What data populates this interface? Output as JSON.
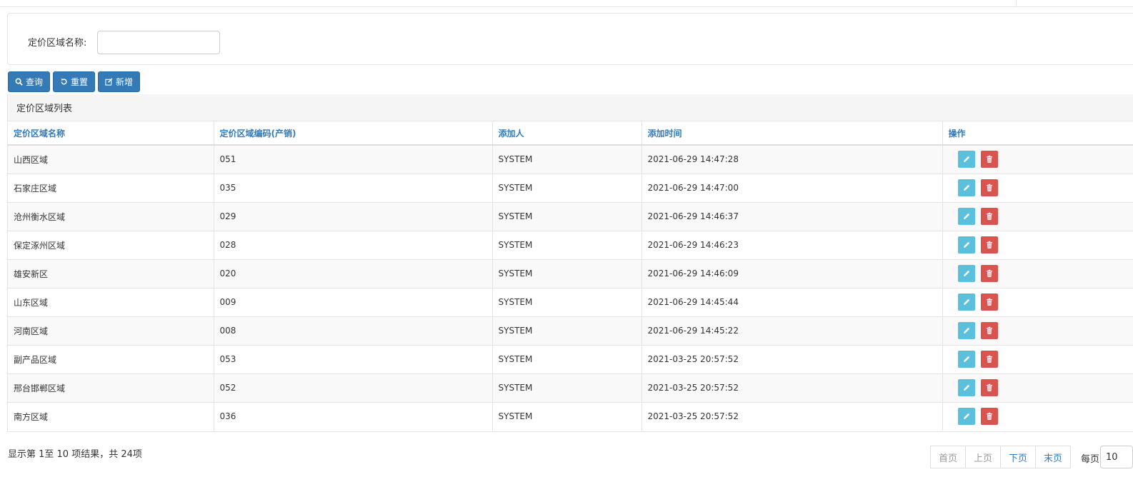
{
  "search": {
    "label": "定价区域名称:",
    "value": "",
    "placeholder": ""
  },
  "toolbar": {
    "query_label": "查询",
    "reset_label": "重置",
    "add_label": "新增"
  },
  "list": {
    "heading": "定价区域列表",
    "columns": [
      "定价区域名称",
      "定价区域编码(产销)",
      "添加人",
      "添加时间",
      "操作"
    ],
    "rows": [
      {
        "name": "山西区域",
        "code": "051",
        "creator": "SYSTEM",
        "time": "2021-06-29 14:47:28"
      },
      {
        "name": "石家庄区域",
        "code": "035",
        "creator": "SYSTEM",
        "time": "2021-06-29 14:47:00"
      },
      {
        "name": "沧州衡水区域",
        "code": "029",
        "creator": "SYSTEM",
        "time": "2021-06-29 14:46:37"
      },
      {
        "name": "保定涿州区域",
        "code": "028",
        "creator": "SYSTEM",
        "time": "2021-06-29 14:46:23"
      },
      {
        "name": "雄安新区",
        "code": "020",
        "creator": "SYSTEM",
        "time": "2021-06-29 14:46:09"
      },
      {
        "name": "山东区域",
        "code": "009",
        "creator": "SYSTEM",
        "time": "2021-06-29 14:45:44"
      },
      {
        "name": "河南区域",
        "code": "008",
        "creator": "SYSTEM",
        "time": "2021-06-29 14:45:22"
      },
      {
        "name": "副产品区域",
        "code": "053",
        "creator": "SYSTEM",
        "time": "2021-03-25 20:57:52"
      },
      {
        "name": "邢台邯郸区域",
        "code": "052",
        "creator": "SYSTEM",
        "time": "2021-03-25 20:57:52"
      },
      {
        "name": "南方区域",
        "code": "036",
        "creator": "SYSTEM",
        "time": "2021-03-25 20:57:52"
      }
    ],
    "row_actions": {
      "edit_icon": "pencil-icon",
      "delete_icon": "trash-icon"
    }
  },
  "footer": {
    "summary": "显示第 1至 10 项结果，共 24项",
    "pager": {
      "first": "首页",
      "prev": "上页",
      "next": "下页",
      "last": "末页"
    },
    "page_size_label": "每页",
    "page_size": "10"
  },
  "colors": {
    "primary": "#337ab7",
    "edit": "#5bc0de",
    "delete": "#d9534f"
  }
}
